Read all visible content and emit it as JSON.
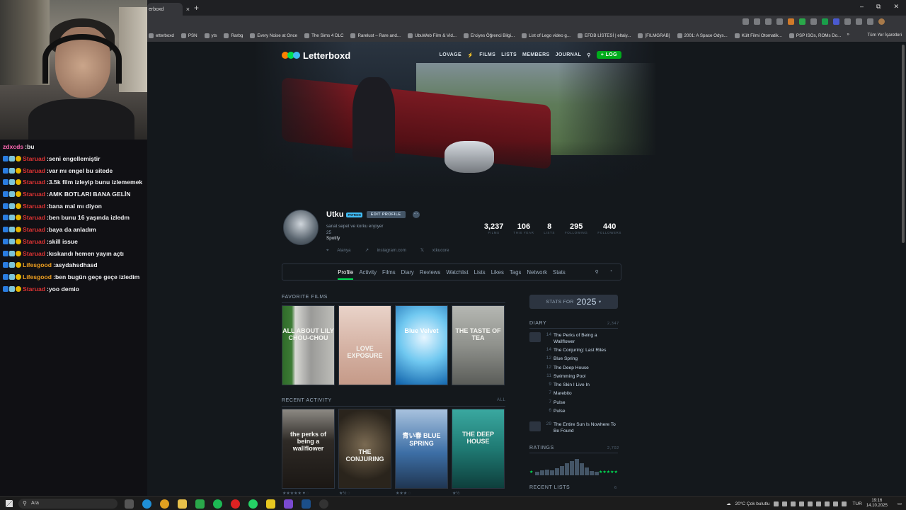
{
  "stream": {
    "chat": [
      {
        "user": "zdxcds",
        "color": "#ff69b4",
        "message": "bu",
        "badges": false
      },
      {
        "user": "Staruad",
        "color": "#d33",
        "message": "seni engellemiştir",
        "badges": true
      },
      {
        "user": "Staruad",
        "color": "#d33",
        "message": "var mı engel bu sitede",
        "badges": true
      },
      {
        "user": "Staruad",
        "color": "#d33",
        "message": "3.5k film izleyip bunu izlememek",
        "badges": true
      },
      {
        "user": "Staruad",
        "color": "#d33",
        "message": "AMK BOTLARI BANA GELİN",
        "badges": true
      },
      {
        "user": "Staruad",
        "color": "#d33",
        "message": "bana mal mı diyon",
        "badges": true
      },
      {
        "user": "Staruad",
        "color": "#d33",
        "message": "ben bunu 16 yaşında izledm",
        "badges": true
      },
      {
        "user": "Staruad",
        "color": "#d33",
        "message": "baya da anladım",
        "badges": true
      },
      {
        "user": "Staruad",
        "color": "#d33",
        "message": "skill issue",
        "badges": true
      },
      {
        "user": "Staruad",
        "color": "#d33",
        "message": "kıskandı hemen yayın açtı",
        "badges": true
      },
      {
        "user": "Lifesgood",
        "color": "#f0a020",
        "message": "asydahsdhasd",
        "badges": true
      },
      {
        "user": "Lifesgood",
        "color": "#f0a020",
        "message": "ben bugün geçe geçe izledim",
        "badges": true
      },
      {
        "user": "Staruad",
        "color": "#d33",
        "message": "yoo demio",
        "badges": true
      }
    ]
  },
  "browser": {
    "tab_title": "erboxd",
    "new_tab": "+",
    "close": "×",
    "window_controls": [
      "–",
      "⧉",
      "✕"
    ],
    "bookmarks": [
      "etterboxd",
      "PSN",
      "yts",
      "Rarbg",
      "Every Noise at Once",
      "The Sims 4 DLC",
      "Rarelust – Rare and...",
      "UbuWeb Film & Vid...",
      "Erciyes Öğrenci Bilgi...",
      "List of Lego video g...",
      "EFDB LİSTESİ | eltaiy...",
      "[FILMGRAB]",
      "2001: A Space Odys...",
      "Kült Filmi Otomatik...",
      "PSP ISOs, ROMs Do..."
    ],
    "bookmarks_more": "»",
    "other_bookmarks": "Tüm Yer İşaretleri"
  },
  "letterboxd": {
    "logo": "Letterboxd",
    "nav": {
      "user": "LOVAGE",
      "films": "FILMS",
      "lists": "LISTS",
      "members": "MEMBERS",
      "journal": "JOURNAL",
      "log": "+ LOG"
    },
    "profile": {
      "name": "Utku",
      "badge": "PATRON",
      "edit": "EDIT PROFILE",
      "more": "···",
      "bio_line1": "sanat sepet ve korku enjoyer",
      "bio_line2": "25",
      "bio_line3": "Spotify",
      "location": "Alanya",
      "website": "instagram.com",
      "twitter": "xtkucore"
    },
    "stats": [
      {
        "value": "3,237",
        "label": "FILMS"
      },
      {
        "value": "106",
        "label": "THIS YEAR"
      },
      {
        "value": "8",
        "label": "LISTS"
      },
      {
        "value": "295",
        "label": "FOLLOWING"
      },
      {
        "value": "440",
        "label": "FOLLOWERS"
      }
    ],
    "tabs": [
      "Profile",
      "Activity",
      "Films",
      "Diary",
      "Reviews",
      "Watchlist",
      "Lists",
      "Likes",
      "Tags",
      "Network",
      "Stats"
    ],
    "favorite_films_title": "FAVORITE FILMS",
    "favorite_posters": [
      {
        "text": "ALL ABOUT LILY CHOU-CHOU"
      },
      {
        "text": "LOVE EXPOSURE"
      },
      {
        "text": "Blue Velvet"
      },
      {
        "text": "THE TASTE OF TEA"
      }
    ],
    "recent_activity_title": "RECENT ACTIVITY",
    "recent_all": "ALL",
    "recent_posters": [
      {
        "text": "the perks of being a wallflower",
        "rating": "★★★★★ ♥ ◌"
      },
      {
        "text": "THE CONJURING",
        "rating": "★½ ◌"
      },
      {
        "text": "青い春 BLUE SPRING",
        "rating": "★★★ ◌"
      },
      {
        "text": "THE DEEP HOUSE",
        "rating": "★½"
      }
    ],
    "stats_for": "STATS FOR",
    "stats_year": "2025",
    "diary_title": "DIARY",
    "diary_count": "2,347",
    "diary": [
      {
        "day": "14",
        "title": "The Perks of Being a Wallflower"
      },
      {
        "day": "14",
        "title": "The Conjuring: Last Rites"
      },
      {
        "day": "12",
        "title": "Blue Spring"
      },
      {
        "day": "12",
        "title": "The Deep House"
      },
      {
        "day": "11",
        "title": "Swimming Pool"
      },
      {
        "day": "9",
        "title": "The Skin I Live In"
      },
      {
        "day": "7",
        "title": "Marebito"
      },
      {
        "day": "7",
        "title": "Pulse"
      },
      {
        "day": "6",
        "title": "Pulse"
      }
    ],
    "diary_sep": {
      "day": "29",
      "title": "The Entire Sun Is Nowhere To Be Found"
    },
    "ratings_title": "RATINGS",
    "ratings_count": "2,702",
    "ratings_hist": [
      0.2,
      0.3,
      0.35,
      0.3,
      0.4,
      0.55,
      0.7,
      0.85,
      0.95,
      0.7,
      0.45,
      0.25,
      0.2
    ],
    "star_low": "★",
    "star_high": "★★★★★",
    "recent_lists_title": "RECENT LISTS",
    "recent_lists_count": "6"
  },
  "taskbar": {
    "search": "Ara",
    "weather": "20°C Çok bulutlu",
    "lang": "TUR",
    "time": "19:16",
    "date": "14.10.2025"
  }
}
